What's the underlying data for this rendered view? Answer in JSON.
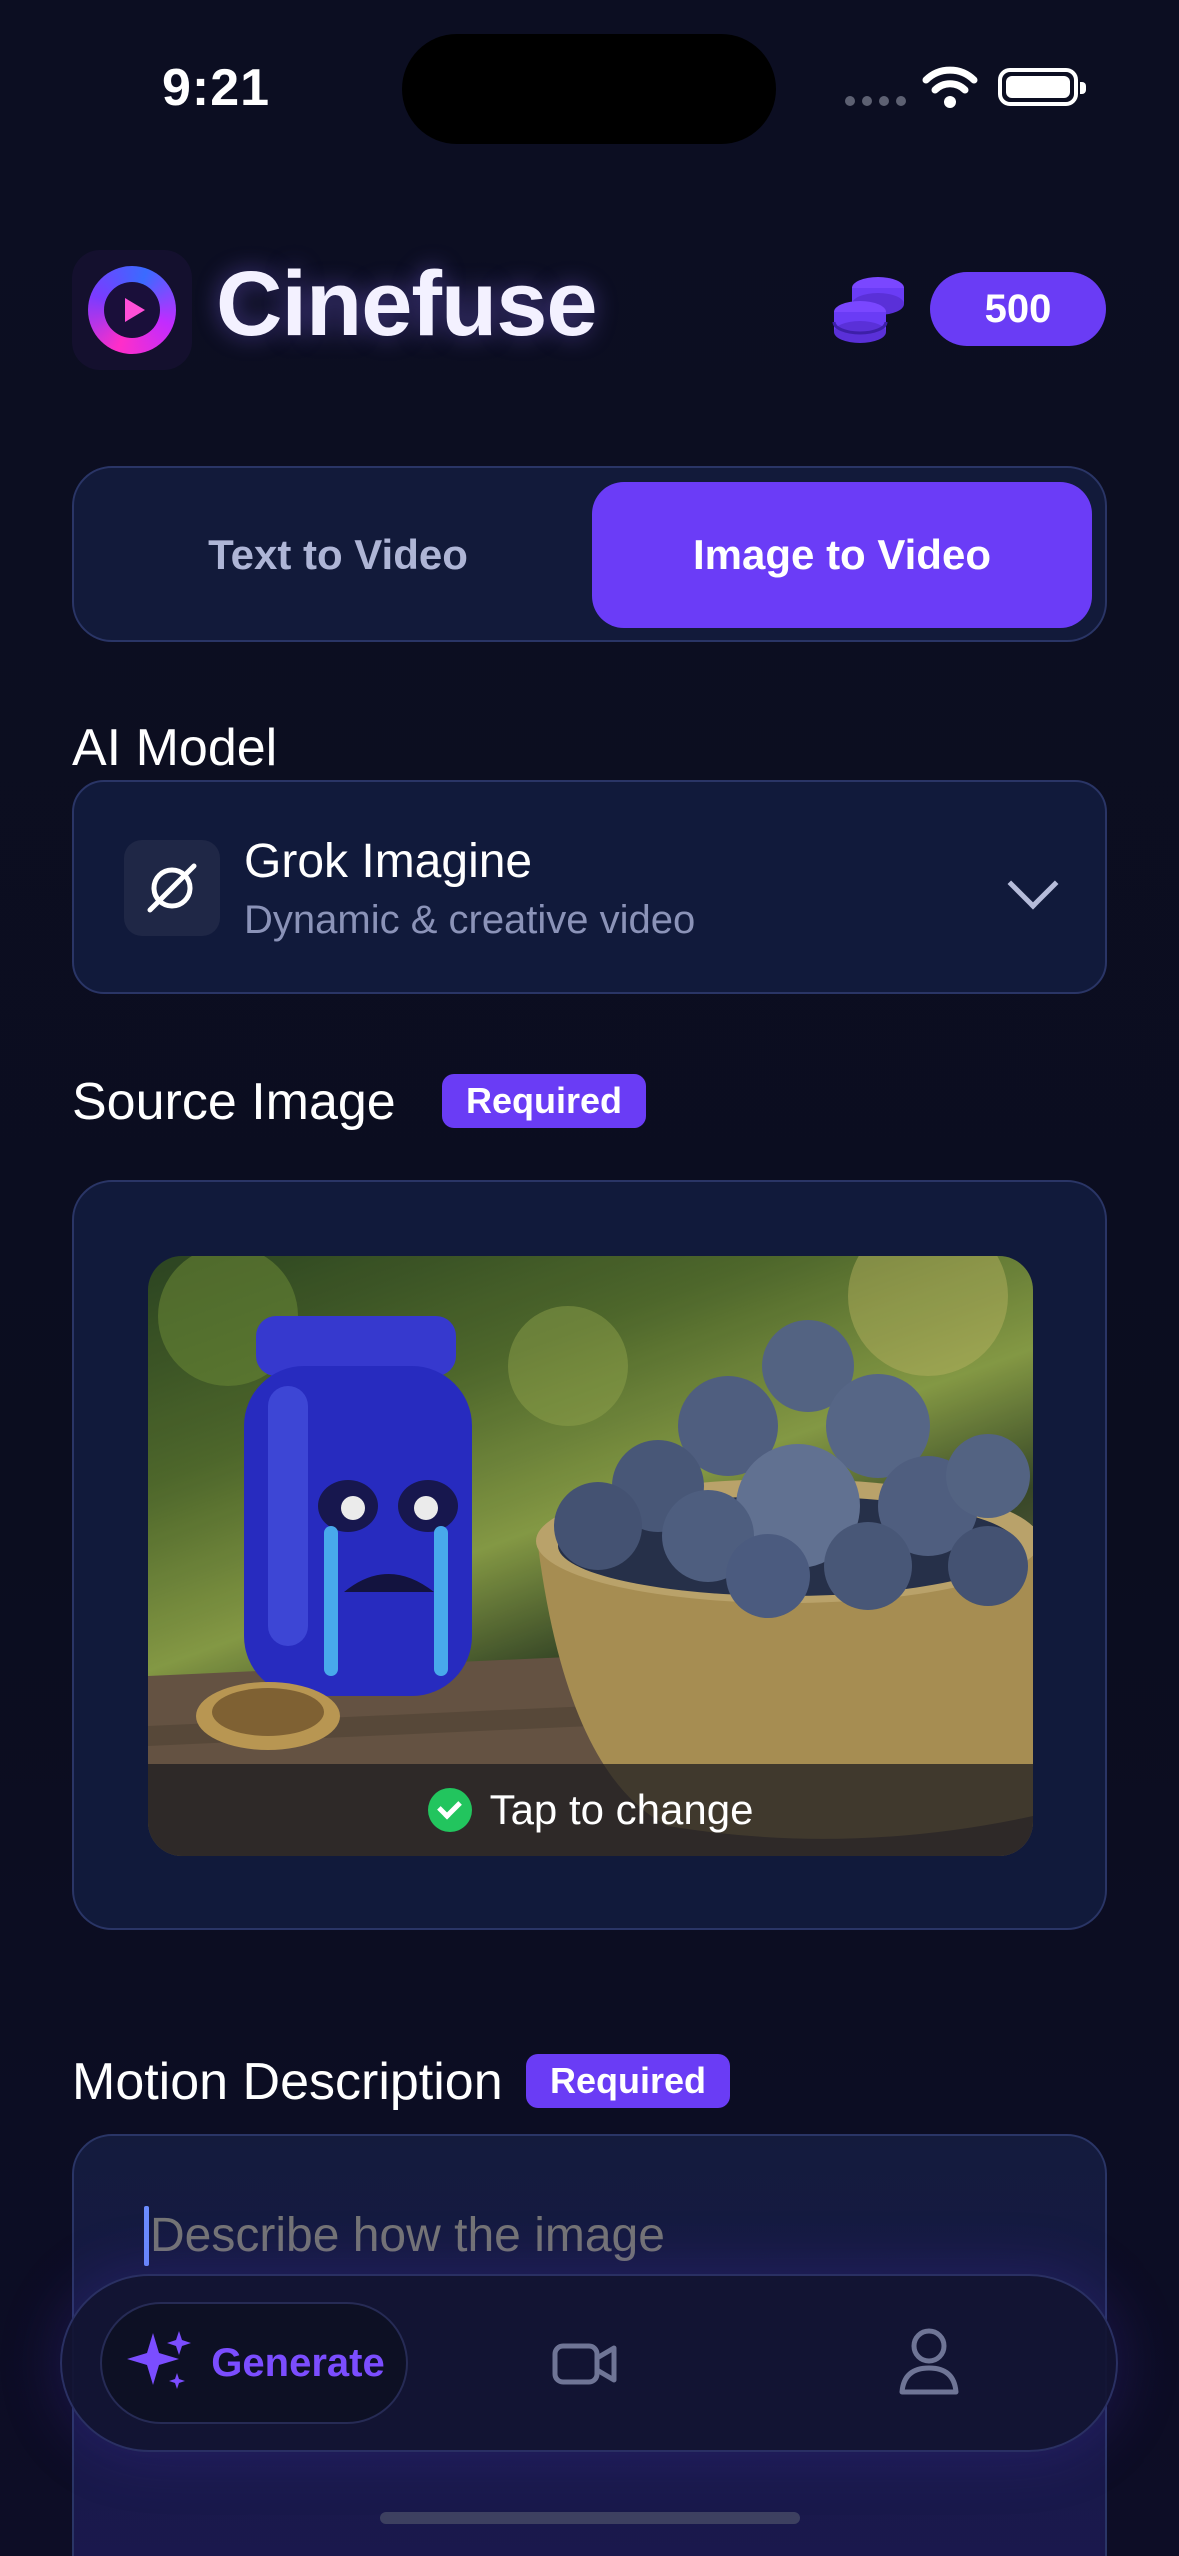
{
  "status_bar": {
    "time": "9:21"
  },
  "header": {
    "app_name": "Cinefuse",
    "credits": "500"
  },
  "mode_tabs": [
    {
      "label": "Text to Video",
      "active": false
    },
    {
      "label": "Image to Video",
      "active": true
    }
  ],
  "model_section": {
    "label": "AI Model",
    "selected_model": {
      "name": "Grok Imagine",
      "description": "Dynamic & creative video"
    }
  },
  "source_image": {
    "label": "Source Image",
    "badge": "Required",
    "overlay_text": "Tap to change"
  },
  "motion": {
    "label": "Motion Description",
    "badge": "Required",
    "placeholder": "Describe how the image"
  },
  "tab_bar": {
    "generate_label": "Generate",
    "items": [
      "generate",
      "videos",
      "profile"
    ]
  },
  "colors": {
    "accent": "#6b3cf7",
    "background": "#0b0d1f",
    "card": "#111a3b",
    "success": "#22c55e"
  }
}
